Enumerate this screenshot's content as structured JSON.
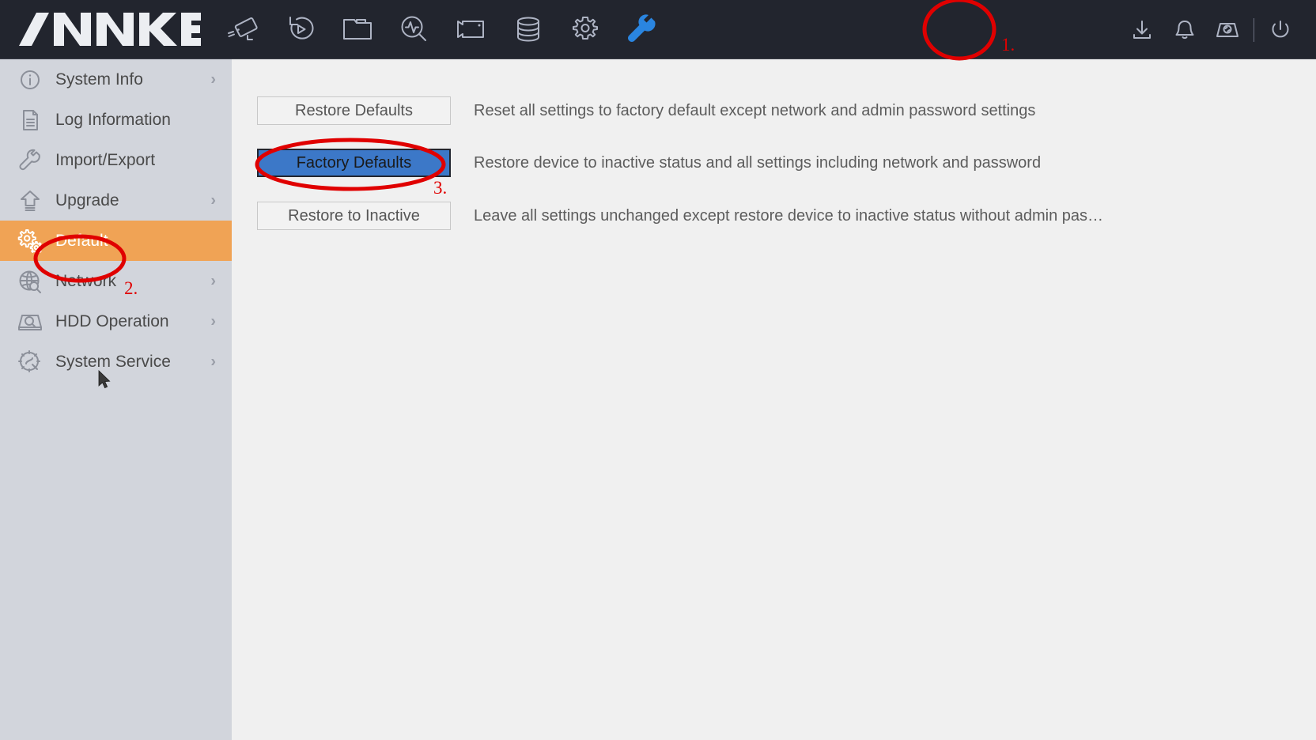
{
  "app": {
    "brand": "ANNKE",
    "accent_blue": "#2a85e0",
    "highlight_orange": "#f0a355",
    "focus_blue": "#3c78c8",
    "annotation_red": "#e00000",
    "header_bg": "#22252e",
    "sidebar_bg": "#d2d5dc",
    "content_bg": "#f0f0f0"
  },
  "header": {
    "nav": [
      {
        "name": "camera-icon",
        "label": "Live View"
      },
      {
        "name": "playback-icon",
        "label": "Playback"
      },
      {
        "name": "folder-icon",
        "label": "File Management"
      },
      {
        "name": "smart-search-icon",
        "label": "Smart Analysis"
      },
      {
        "name": "camcorder-icon",
        "label": "Camera Management"
      },
      {
        "name": "storage-icon",
        "label": "Storage"
      },
      {
        "name": "gear-icon",
        "label": "System Configuration"
      },
      {
        "name": "wrench-icon",
        "label": "Maintenance",
        "active": true
      }
    ],
    "right_icons": [
      {
        "name": "download-icon",
        "label": "Download"
      },
      {
        "name": "bell-icon",
        "label": "Alarm"
      },
      {
        "name": "backup-icon",
        "label": "Backup"
      },
      {
        "name": "power-icon",
        "label": "Power"
      }
    ]
  },
  "sidebar": {
    "items": [
      {
        "label": "System Info",
        "icon": "info-circle-icon",
        "chevron": "›",
        "selected": false
      },
      {
        "label": "Log Information",
        "icon": "document-icon",
        "chevron": "",
        "selected": false
      },
      {
        "label": "Import/Export",
        "icon": "wrench-icon",
        "chevron": "",
        "selected": false
      },
      {
        "label": "Upgrade",
        "icon": "upload-arrow-icon",
        "chevron": "›",
        "selected": false
      },
      {
        "label": "Default",
        "icon": "gears-icon",
        "chevron": "",
        "selected": true
      },
      {
        "label": "Network",
        "icon": "globe-search-icon",
        "chevron": "›",
        "selected": false
      },
      {
        "label": "HDD Operation",
        "icon": "hdd-search-icon",
        "chevron": "›",
        "selected": false
      },
      {
        "label": "System Service",
        "icon": "service-gear-icon",
        "chevron": "›",
        "selected": false
      }
    ]
  },
  "main": {
    "rows": [
      {
        "button": "Restore Defaults",
        "description": "Reset all settings to factory default except network and admin password settings",
        "focused": false
      },
      {
        "button": "Factory Defaults",
        "description": "Restore device to inactive status and all settings including network and password",
        "focused": true
      },
      {
        "button": "Restore to Inactive",
        "description": "Leave all settings unchanged except restore device to inactive status without admin pas…",
        "focused": false
      }
    ]
  },
  "annotations": {
    "steps": [
      {
        "number": "1.",
        "target": "wrench-icon"
      },
      {
        "number": "2.",
        "target": "sidebar-item-default"
      },
      {
        "number": "3.",
        "target": "factory-defaults-button"
      }
    ]
  }
}
